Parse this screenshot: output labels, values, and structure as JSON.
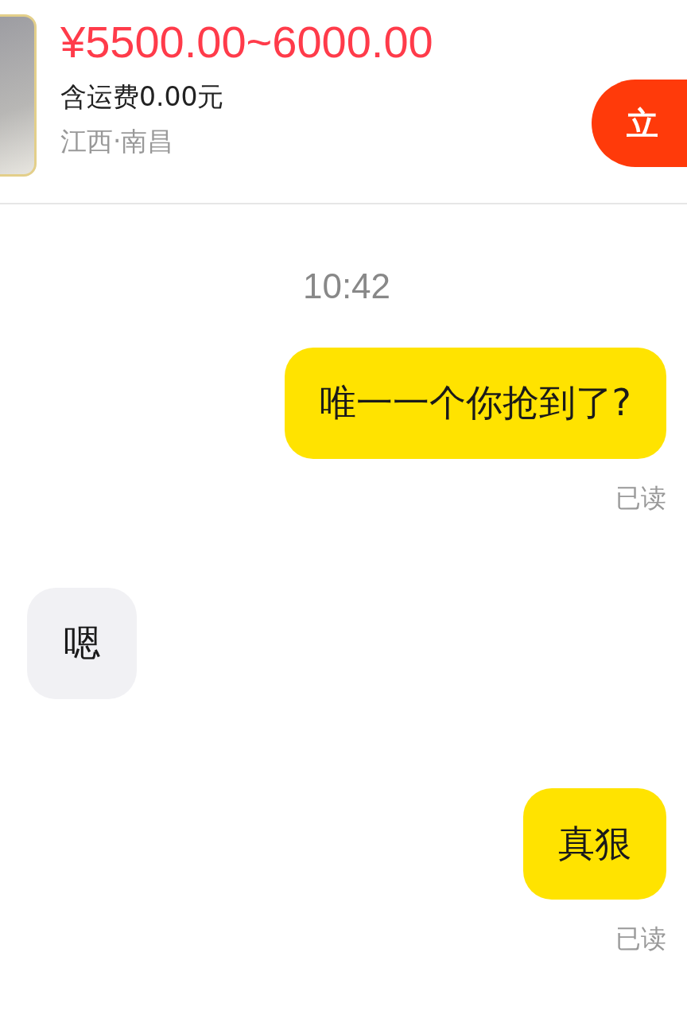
{
  "product": {
    "price": "¥5500.00~6000.00",
    "shipping": "含运费0.00元",
    "location": "江西·南昌",
    "action_button": "立"
  },
  "timestamp": "10:42",
  "messages": [
    {
      "kind": "sent",
      "text": "唯一一个你抢到了?",
      "status": "已读"
    },
    {
      "kind": "received",
      "text": "嗯"
    },
    {
      "kind": "sent",
      "text": "真狠",
      "status": "已读"
    }
  ]
}
